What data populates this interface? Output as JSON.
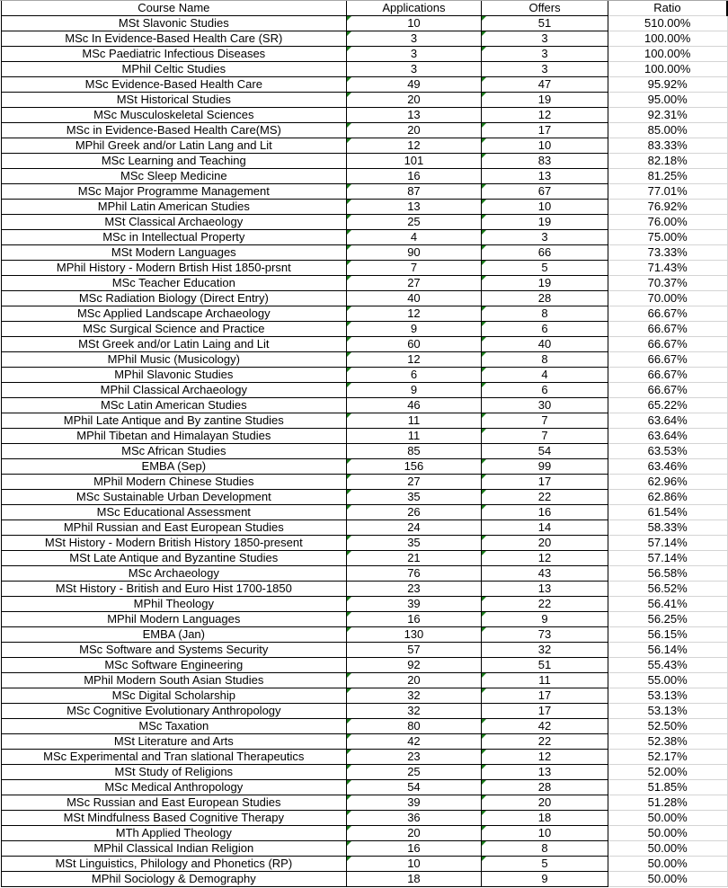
{
  "columns": [
    "Course Name",
    "Applications",
    "Offers",
    "Ratio"
  ],
  "rows": [
    {
      "course": "MSt Slavonic Studies",
      "applications": "10",
      "offers": "51",
      "ratio": "510.00%",
      "flag_apps": true,
      "flag_offers": true
    },
    {
      "course": "MSc In Evidence-Based Health Care (SR)",
      "applications": "3",
      "offers": "3",
      "ratio": "100.00%",
      "flag_apps": true,
      "flag_offers": true
    },
    {
      "course": "MSc Paediatric Infectious Diseases",
      "applications": "3",
      "offers": "3",
      "ratio": "100.00%",
      "flag_apps": true,
      "flag_offers": true
    },
    {
      "course": "MPhil Celtic Studies",
      "applications": "3",
      "offers": "3",
      "ratio": "100.00%",
      "flag_apps": false,
      "flag_offers": false
    },
    {
      "course": "MSc Evidence-Based Health Care",
      "applications": "49",
      "offers": "47",
      "ratio": "95.92%",
      "flag_apps": true,
      "flag_offers": true
    },
    {
      "course": "MSt Historical Studies",
      "applications": "20",
      "offers": "19",
      "ratio": "95.00%",
      "flag_apps": true,
      "flag_offers": true
    },
    {
      "course": "MSc Musculoskeletal Sciences",
      "applications": "13",
      "offers": "12",
      "ratio": "92.31%",
      "flag_apps": false,
      "flag_offers": false
    },
    {
      "course": "MSc in Evidence-Based Health Care(MS)",
      "applications": "20",
      "offers": "17",
      "ratio": "85.00%",
      "flag_apps": true,
      "flag_offers": true
    },
    {
      "course": "MPhil Greek and/or Latin Lang and Lit",
      "applications": "12",
      "offers": "10",
      "ratio": "83.33%",
      "flag_apps": true,
      "flag_offers": true
    },
    {
      "course": "MSc Learning and Teaching",
      "applications": "101",
      "offers": "83",
      "ratio": "82.18%",
      "flag_apps": false,
      "flag_offers": true
    },
    {
      "course": "MSc Sleep Medicine",
      "applications": "16",
      "offers": "13",
      "ratio": "81.25%",
      "flag_apps": false,
      "flag_offers": false
    },
    {
      "course": "MSc Major Programme Management",
      "applications": "87",
      "offers": "67",
      "ratio": "77.01%",
      "flag_apps": true,
      "flag_offers": true
    },
    {
      "course": "MPhil Latin American Studies",
      "applications": "13",
      "offers": "10",
      "ratio": "76.92%",
      "flag_apps": true,
      "flag_offers": true
    },
    {
      "course": "MSt Classical Archaeology",
      "applications": "25",
      "offers": "19",
      "ratio": "76.00%",
      "flag_apps": true,
      "flag_offers": true
    },
    {
      "course": "MSc in Intellectual Property",
      "applications": "4",
      "offers": "3",
      "ratio": "75.00%",
      "flag_apps": true,
      "flag_offers": true
    },
    {
      "course": "MSt Modern Languages",
      "applications": "90",
      "offers": "66",
      "ratio": "73.33%",
      "flag_apps": true,
      "flag_offers": true
    },
    {
      "course": "MPhil History - Modern Brtish Hist 1850-prsnt",
      "applications": "7",
      "offers": "5",
      "ratio": "71.43%",
      "flag_apps": true,
      "flag_offers": true
    },
    {
      "course": "MSc Teacher Education",
      "applications": "27",
      "offers": "19",
      "ratio": "70.37%",
      "flag_apps": true,
      "flag_offers": true
    },
    {
      "course": "MSc Radiation Biology (Direct Entry)",
      "applications": "40",
      "offers": "28",
      "ratio": "70.00%",
      "flag_apps": false,
      "flag_offers": false
    },
    {
      "course": "MSc Applied Landscape Archaeology",
      "applications": "12",
      "offers": "8",
      "ratio": "66.67%",
      "flag_apps": true,
      "flag_offers": true
    },
    {
      "course": "MSc Surgical Science and Practice",
      "applications": "9",
      "offers": "6",
      "ratio": "66.67%",
      "flag_apps": true,
      "flag_offers": true
    },
    {
      "course": "MSt Greek and/or Latin Laing and Lit",
      "applications": "60",
      "offers": "40",
      "ratio": "66.67%",
      "flag_apps": true,
      "flag_offers": true
    },
    {
      "course": "MPhil Music (Musicology)",
      "applications": "12",
      "offers": "8",
      "ratio": "66.67%",
      "flag_apps": true,
      "flag_offers": true
    },
    {
      "course": "MPhil Slavonic Studies",
      "applications": "6",
      "offers": "4",
      "ratio": "66.67%",
      "flag_apps": true,
      "flag_offers": true
    },
    {
      "course": "MPhil Classical Archaeology",
      "applications": "9",
      "offers": "6",
      "ratio": "66.67%",
      "flag_apps": true,
      "flag_offers": true
    },
    {
      "course": "MSc Latin American Studies",
      "applications": "46",
      "offers": "30",
      "ratio": "65.22%",
      "flag_apps": false,
      "flag_offers": false
    },
    {
      "course": "MPhil Late Antique and By zantine Studies",
      "applications": "11",
      "offers": "7",
      "ratio": "63.64%",
      "flag_apps": true,
      "flag_offers": true
    },
    {
      "course": "MPhil Tibetan and Himalayan Studies",
      "applications": "11",
      "offers": "7",
      "ratio": "63.64%",
      "flag_apps": false,
      "flag_offers": true
    },
    {
      "course": "MSc African Studies",
      "applications": "85",
      "offers": "54",
      "ratio": "63.53%",
      "flag_apps": false,
      "flag_offers": false
    },
    {
      "course": "EMBA   (Sep)",
      "applications": "156",
      "offers": "99",
      "ratio": "63.46%",
      "flag_apps": true,
      "flag_offers": true
    },
    {
      "course": "MPhil Modern Chinese Studies",
      "applications": "27",
      "offers": "17",
      "ratio": "62.96%",
      "flag_apps": true,
      "flag_offers": true
    },
    {
      "course": "MSc Sustainable Urban Development",
      "applications": "35",
      "offers": "22",
      "ratio": "62.86%",
      "flag_apps": true,
      "flag_offers": true
    },
    {
      "course": "MSc Educational Assessment",
      "applications": "26",
      "offers": "16",
      "ratio": "61.54%",
      "flag_apps": true,
      "flag_offers": true
    },
    {
      "course": "MPhil Russian and East European Studies",
      "applications": "24",
      "offers": "14",
      "ratio": "58.33%",
      "flag_apps": false,
      "flag_offers": false
    },
    {
      "course": "MSt History - Modern British History 1850-present",
      "applications": "35",
      "offers": "20",
      "ratio": "57.14%",
      "flag_apps": true,
      "flag_offers": true
    },
    {
      "course": "MSt Late Antique and Byzantine Studies",
      "applications": "21",
      "offers": "12",
      "ratio": "57.14%",
      "flag_apps": true,
      "flag_offers": true
    },
    {
      "course": "MSc Archaeology",
      "applications": "76",
      "offers": "43",
      "ratio": "56.58%",
      "flag_apps": false,
      "flag_offers": false
    },
    {
      "course": "MSt History - British and Euro Hist 1700-1850",
      "applications": "23",
      "offers": "13",
      "ratio": "56.52%",
      "flag_apps": false,
      "flag_offers": false
    },
    {
      "course": "MPhil Theology",
      "applications": "39",
      "offers": "22",
      "ratio": "56.41%",
      "flag_apps": true,
      "flag_offers": true
    },
    {
      "course": "MPhil Modern Languages",
      "applications": "16",
      "offers": "9",
      "ratio": "56.25%",
      "flag_apps": true,
      "flag_offers": true
    },
    {
      "course": "EMBA (Jan)",
      "applications": "130",
      "offers": "73",
      "ratio": "56.15%",
      "flag_apps": true,
      "flag_offers": true
    },
    {
      "course": "MSc Software and Systems Security",
      "applications": "57",
      "offers": "32",
      "ratio": "56.14%",
      "flag_apps": false,
      "flag_offers": false
    },
    {
      "course": "MSc Software Engineering",
      "applications": "92",
      "offers": "51",
      "ratio": "55.43%",
      "flag_apps": false,
      "flag_offers": false
    },
    {
      "course": "MPhil Modern South Asian Studies",
      "applications": "20",
      "offers": "11",
      "ratio": "55.00%",
      "flag_apps": true,
      "flag_offers": true
    },
    {
      "course": "MSc Digital Scholarship",
      "applications": "32",
      "offers": "17",
      "ratio": "53.13%",
      "flag_apps": true,
      "flag_offers": true
    },
    {
      "course": "MSc Cognitive Evolutionary Anthropology",
      "applications": "32",
      "offers": "17",
      "ratio": "53.13%",
      "flag_apps": false,
      "flag_offers": false
    },
    {
      "course": "MSc Taxation",
      "applications": "80",
      "offers": "42",
      "ratio": "52.50%",
      "flag_apps": true,
      "flag_offers": true
    },
    {
      "course": "MSt Literature and Arts",
      "applications": "42",
      "offers": "22",
      "ratio": "52.38%",
      "flag_apps": true,
      "flag_offers": true
    },
    {
      "course": "MSc Experimental and Tran slational Therapeutics",
      "applications": "23",
      "offers": "12",
      "ratio": "52.17%",
      "flag_apps": true,
      "flag_offers": true
    },
    {
      "course": "MSt Study of Religions",
      "applications": "25",
      "offers": "13",
      "ratio": "52.00%",
      "flag_apps": true,
      "flag_offers": true
    },
    {
      "course": "MSc Medical Anthropology",
      "applications": "54",
      "offers": "28",
      "ratio": "51.85%",
      "flag_apps": true,
      "flag_offers": true
    },
    {
      "course": "MSc Russian and East European Studies",
      "applications": "39",
      "offers": "20",
      "ratio": "51.28%",
      "flag_apps": true,
      "flag_offers": true
    },
    {
      "course": "MSt Mindfulness Based Cognitive Therapy",
      "applications": "36",
      "offers": "18",
      "ratio": "50.00%",
      "flag_apps": true,
      "flag_offers": true
    },
    {
      "course": "MTh Applied Theology",
      "applications": "20",
      "offers": "10",
      "ratio": "50.00%",
      "flag_apps": true,
      "flag_offers": true
    },
    {
      "course": "MPhil Classical Indian Religion",
      "applications": "16",
      "offers": "8",
      "ratio": "50.00%",
      "flag_apps": true,
      "flag_offers": true
    },
    {
      "course": "MSt Linguistics, Philology and Phonetics (RP)",
      "applications": "10",
      "offers": "5",
      "ratio": "50.00%",
      "flag_apps": true,
      "flag_offers": true
    },
    {
      "course": "MPhil Sociology & Demography",
      "applications": "18",
      "offers": "9",
      "ratio": "50.00%",
      "flag_apps": false,
      "flag_offers": false
    }
  ],
  "colors": {
    "grid": "#000000",
    "ratio_grid": "#d4d4d4",
    "flag": "#1a7a1a"
  }
}
